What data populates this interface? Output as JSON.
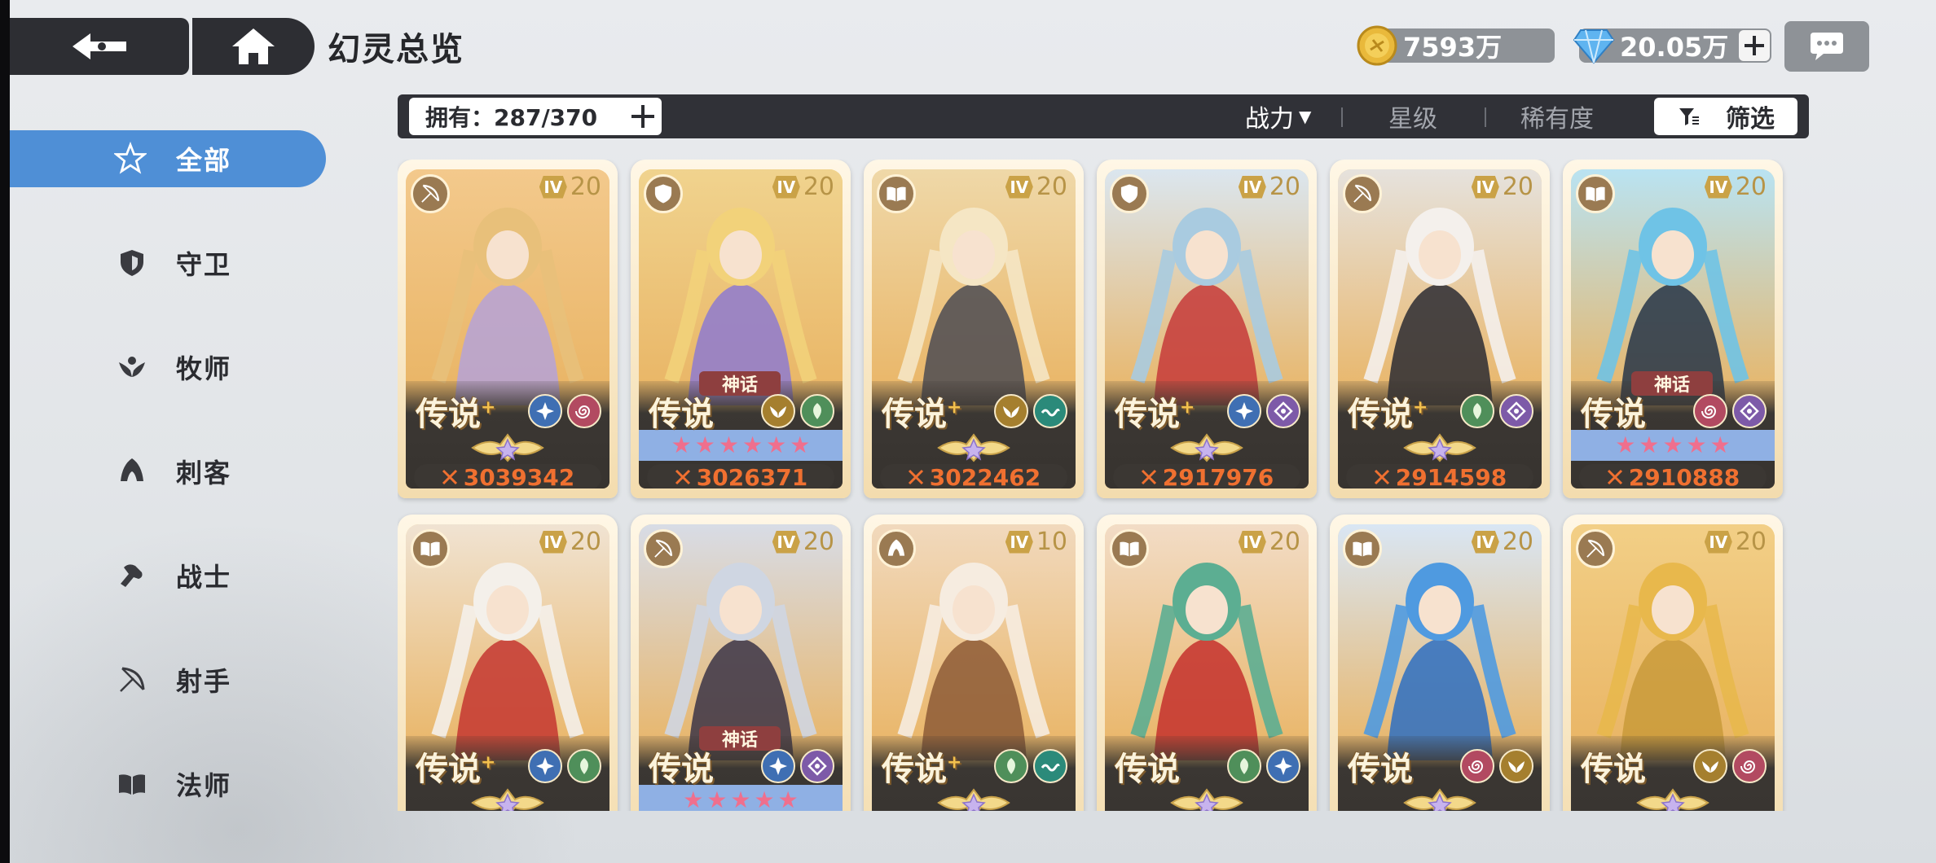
{
  "header": {
    "title": "幻灵总览",
    "gold": "7593万",
    "gems": "20.05万"
  },
  "sidebar": {
    "items": [
      {
        "label": "全部",
        "icon": "all-star-icon",
        "active": true
      },
      {
        "label": "守卫",
        "icon": "shield-icon",
        "active": false
      },
      {
        "label": "牧师",
        "icon": "priest-wings-icon",
        "active": false
      },
      {
        "label": "刺客",
        "icon": "assassin-hood-icon",
        "active": false
      },
      {
        "label": "战士",
        "icon": "warrior-fist-icon",
        "active": false
      },
      {
        "label": "射手",
        "icon": "bow-icon",
        "active": false
      },
      {
        "label": "法师",
        "icon": "book-icon",
        "active": false
      }
    ]
  },
  "filter_bar": {
    "owned": "拥有：287/370",
    "sort_power": "战力",
    "sort_arrow": "▼",
    "sort_stars": "星级",
    "sort_rarity": "稀有度",
    "filter_label": "筛选"
  },
  "cards": [
    {
      "class_icon": "bow-icon",
      "level": "20",
      "rarity": "传说",
      "plus": "+",
      "mythic": "",
      "elements": [
        "star",
        "spiral"
      ],
      "stars": 0,
      "power": "3039342",
      "palette": [
        "#f3c98c",
        "#b5a2d8",
        "#e8c07a"
      ]
    },
    {
      "class_icon": "shield-icon",
      "level": "20",
      "rarity": "传说",
      "plus": "",
      "mythic": "神话",
      "elements": [
        "wing",
        "leaf"
      ],
      "stars": 6,
      "power": "3026371",
      "palette": [
        "#f0d38e",
        "#8e7ad0",
        "#f2d27a"
      ]
    },
    {
      "class_icon": "book-icon",
      "level": "20",
      "rarity": "传说",
      "plus": "+",
      "mythic": "",
      "elements": [
        "wing",
        "wave"
      ],
      "stars": 0,
      "power": "3022462",
      "palette": [
        "#efd8a8",
        "#4c4b52",
        "#f5e6c4"
      ]
    },
    {
      "class_icon": "shield-icon",
      "level": "20",
      "rarity": "传说",
      "plus": "+",
      "mythic": "",
      "elements": [
        "star",
        "diamond"
      ],
      "stars": 0,
      "power": "2917976",
      "palette": [
        "#dbe6ef",
        "#c53a3a",
        "#a9cbe0"
      ]
    },
    {
      "class_icon": "bow-icon",
      "level": "20",
      "rarity": "传说",
      "plus": "+",
      "mythic": "",
      "elements": [
        "leaf",
        "diamond"
      ],
      "stars": 0,
      "power": "2914598",
      "palette": [
        "#e6e2dd",
        "#2c2c33",
        "#f4f0ec"
      ]
    },
    {
      "class_icon": "book-icon",
      "level": "20",
      "rarity": "传说",
      "plus": "",
      "mythic": "神话",
      "elements": [
        "spiral",
        "diamond"
      ],
      "stars": 5,
      "power": "2910888",
      "palette": [
        "#b9e3f2",
        "#263548",
        "#6fc3e6"
      ]
    },
    {
      "class_icon": "book-icon",
      "level": "20",
      "rarity": "传说",
      "plus": "+",
      "mythic": "",
      "elements": [
        "star",
        "leaf"
      ],
      "stars": 0,
      "power": "",
      "palette": [
        "#f0e3d2",
        "#c43630",
        "#f4f0ea"
      ]
    },
    {
      "class_icon": "bow-icon",
      "level": "20",
      "rarity": "传说",
      "plus": "",
      "mythic": "神话",
      "elements": [
        "star",
        "diamond"
      ],
      "stars": 5,
      "power": "",
      "palette": [
        "#d8dce6",
        "#3b3447",
        "#cfd6e2"
      ]
    },
    {
      "class_icon": "assassin-hood-icon",
      "level": "10",
      "rarity": "传说",
      "plus": "+",
      "mythic": "",
      "elements": [
        "leaf",
        "wave"
      ],
      "stars": 0,
      "power": "",
      "palette": [
        "#f1d9bd",
        "#8d5a36",
        "#f6ece0"
      ]
    },
    {
      "class_icon": "book-icon",
      "level": "20",
      "rarity": "传说",
      "plus": "",
      "mythic": "",
      "elements": [
        "leaf",
        "star"
      ],
      "stars": 0,
      "power": "",
      "palette": [
        "#f2dcc6",
        "#c4302d",
        "#5cae92"
      ]
    },
    {
      "class_icon": "book-icon",
      "level": "20",
      "rarity": "传说",
      "plus": "",
      "mythic": "",
      "elements": [
        "spiral",
        "wing"
      ],
      "stars": 0,
      "power": "",
      "palette": [
        "#d9e6f4",
        "#2d6fc2",
        "#4f9ae0"
      ]
    },
    {
      "class_icon": "bow-icon",
      "level": "20",
      "rarity": "传说",
      "plus": "",
      "mythic": "",
      "elements": [
        "wing",
        "spiral"
      ],
      "stars": 0,
      "power": "",
      "palette": [
        "#f2cf86",
        "#c99a3a",
        "#e8b84c"
      ]
    }
  ],
  "colors": {
    "accent": "#4f8fd6",
    "dark_panel": "#2d2e33",
    "power_text": "#f07030"
  }
}
